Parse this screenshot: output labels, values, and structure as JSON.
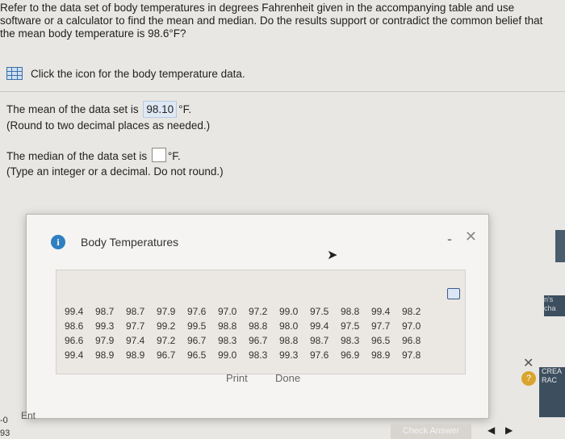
{
  "question": {
    "text": "Refer to the data set of body temperatures in degrees Fahrenheit given in the accompanying table and use software or a calculator to find the mean and median. Do the results support or contradict the common belief that the mean body temperature is 98.6°F?"
  },
  "data_link": {
    "icon": "grid-icon",
    "label": "Click the icon for the body temperature data."
  },
  "mean": {
    "prefix": "The mean of the data set is",
    "value": "98.10",
    "unit": "°F.",
    "hint": "(Round to two decimal places as needed.)"
  },
  "median": {
    "prefix": "The median of the data set is",
    "value": "",
    "unit": "°F.",
    "hint": "(Type an integer or a decimal. Do not round.)"
  },
  "modal": {
    "title": "Body Temperatures",
    "minimize_label": "-",
    "close_label": "✕",
    "rows": [
      [
        "99.4",
        "98.7",
        "98.7",
        "97.9",
        "97.6",
        "97.0",
        "97.2",
        "99.0",
        "97.5",
        "98.8",
        "99.4",
        "98.2"
      ],
      [
        "98.6",
        "99.3",
        "97.7",
        "99.2",
        "99.5",
        "98.8",
        "98.8",
        "98.0",
        "99.4",
        "97.5",
        "97.7",
        "97.0"
      ],
      [
        "96.6",
        "97.9",
        "97.4",
        "97.2",
        "96.7",
        "98.3",
        "96.7",
        "98.8",
        "98.7",
        "98.3",
        "96.5",
        "96.8"
      ],
      [
        "99.4",
        "98.9",
        "98.9",
        "96.7",
        "96.5",
        "99.0",
        "98.3",
        "99.3",
        "97.6",
        "96.9",
        "98.9",
        "97.8"
      ]
    ],
    "print_label": "Print",
    "done_label": "Done"
  },
  "footer": {
    "enter_label": "Ent",
    "check_answer_label": "Check Answer",
    "help_label": "?",
    "x_mark": "✕",
    "side_labels": {
      "top": "n's cha",
      "bottom": "CREA RAC"
    },
    "corner_top": "-0",
    "corner_bot": "93"
  },
  "colors": {
    "info_blue": "#2f7fc1",
    "answer_fill": "#dfe9f5",
    "help_gold": "#d9a52e",
    "side_dark": "#3d4f5f"
  }
}
